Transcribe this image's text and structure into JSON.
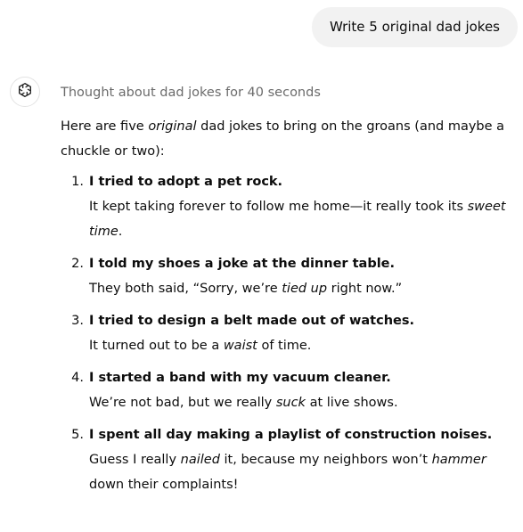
{
  "user_message": "Write 5 original dad jokes",
  "assistant": {
    "avatar_icon": "chatgpt-logo-icon",
    "thought_label": "Thought about dad jokes for 40 seconds",
    "intro": {
      "before": "Here are five ",
      "emph": "original",
      "after": " dad jokes to bring on the groans (and maybe a chuckle or two):"
    },
    "jokes": [
      {
        "num": "1.",
        "setup": "I tried to adopt a pet rock.",
        "p1": "It kept taking forever to follow me home—it really took its ",
        "e1": "sweet time",
        "p2": "."
      },
      {
        "num": "2.",
        "setup": "I told my shoes a joke at the dinner table.",
        "p1": "They both said, “Sorry, we’re ",
        "e1": "tied up",
        "p2": " right now.”"
      },
      {
        "num": "3.",
        "setup": "I tried to design a belt made out of watches.",
        "p1": "It turned out to be a ",
        "e1": "waist",
        "p2": " of time."
      },
      {
        "num": "4.",
        "setup": "I started a band with my vacuum cleaner.",
        "p1": "We’re not bad, but we really ",
        "e1": "suck",
        "p2": " at live shows."
      },
      {
        "num": "5.",
        "setup": "I spent all day making a playlist of construction noises.",
        "p1": "Guess I really ",
        "e1": "nailed",
        "p2": " it, because my neighbors won’t ",
        "e2": "hammer",
        "p3": " down their complaints!"
      }
    ]
  }
}
